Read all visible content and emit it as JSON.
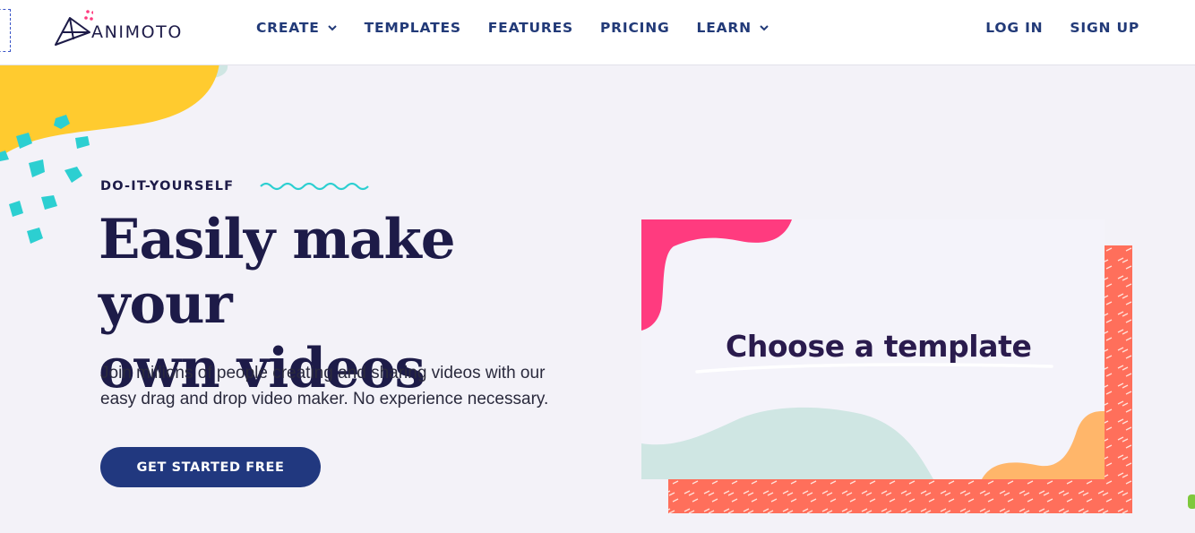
{
  "header": {
    "logo_text": "ANIMOTO",
    "nav": [
      {
        "label": "CREATE",
        "has_dropdown": true
      },
      {
        "label": "TEMPLATES",
        "has_dropdown": false
      },
      {
        "label": "FEATURES",
        "has_dropdown": false
      },
      {
        "label": "PRICING",
        "has_dropdown": false
      },
      {
        "label": "LEARN",
        "has_dropdown": true
      }
    ],
    "login_label": "LOG IN",
    "signup_label": "SIGN UP"
  },
  "hero": {
    "eyebrow": "DO-IT-YOURSELF",
    "headline_line1": "Easily make your",
    "headline_line2": "own videos",
    "subtext_line1": "Join millions of people creating and sharing videos with our",
    "subtext_line2": "easy drag and drop video maker. No experience necessary.",
    "cta_label": "GET STARTED FREE"
  },
  "illustration": {
    "card_title": "Choose a template"
  },
  "colors": {
    "navy": "#1d1b48",
    "nav_blue": "#223a78",
    "cta_blue": "#21387f",
    "yellow": "#ffcb2f",
    "teal": "#2ccfd1",
    "pink": "#ff3b7f",
    "coral": "#ff6f5b",
    "mint": "#cfe6e3",
    "orange": "#ffb66a",
    "background": "#f3f2f8"
  },
  "icons": [
    "animoto-logo-icon",
    "chevron-down-icon"
  ]
}
